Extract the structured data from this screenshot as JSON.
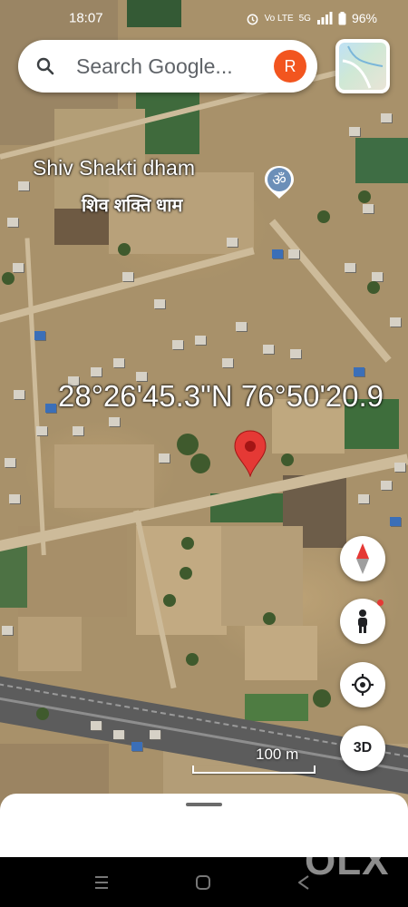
{
  "status_bar": {
    "time": "18:07",
    "network_badge": "Vo LTE",
    "network_type": "5G",
    "battery": "96%",
    "icons": [
      "alarm-icon",
      "wifi-icon",
      "signal-icon",
      "battery-icon"
    ]
  },
  "search": {
    "placeholder": "Search Google...",
    "avatar_letter": "R",
    "avatar_color": "#F2551F"
  },
  "place": {
    "name_en": "Shiv Shakti dham",
    "name_hi": "शिव शक्ति धाम",
    "icon": "om-icon"
  },
  "map": {
    "coordinates": "28°26'45.3\"N 76°50'20.9",
    "view": "satellite",
    "scale_label": "100 m",
    "three_d_label": "3D"
  },
  "watermark": "OLX",
  "colors": {
    "pin_red": "#E53935",
    "accent_blue": "#1A73E8"
  }
}
